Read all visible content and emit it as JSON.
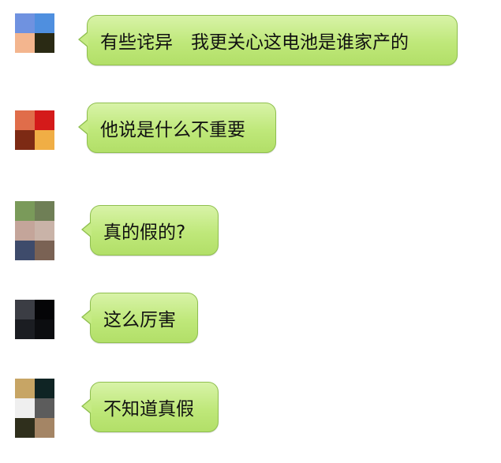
{
  "messages": [
    {
      "text": "有些诧异　我更关心这电池是谁家产的",
      "avatar": {
        "colors": [
          "#6f92e0",
          "#4f8fdf",
          "#f3b58e",
          "#2a2a14"
        ]
      }
    },
    {
      "text": "他说是什么不重要",
      "avatar": {
        "colors": [
          "#e06d4a",
          "#d41a1a",
          "#7d2a14",
          "#f0ae45"
        ]
      }
    },
    {
      "text": "真的假的?",
      "avatar": {
        "colors": [
          "#7a9a5a",
          "#6f7f56",
          "#c4a59a",
          "#c9b3a8",
          "#3e4b6b",
          "#7a6254"
        ]
      }
    },
    {
      "text": "这么厉害",
      "avatar": {
        "colors": [
          "#3b3d44",
          "#050507",
          "#1b1d22",
          "#0c0d10"
        ]
      }
    },
    {
      "text": "不知道真假",
      "avatar": {
        "colors": [
          "#c7a565",
          "#0f2424",
          "#efefef",
          "#5c5c5c",
          "#2f2f1c",
          "#a48565"
        ]
      }
    }
  ]
}
